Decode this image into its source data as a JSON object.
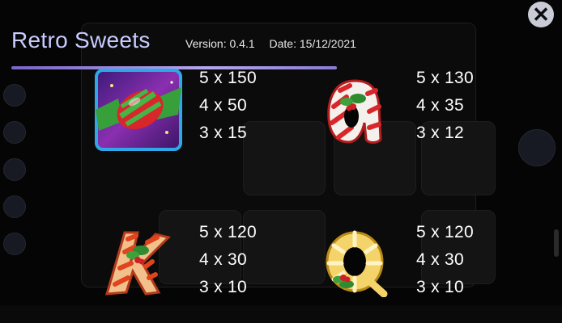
{
  "header": {
    "title": "Retro Sweets",
    "version": "Version: 0.4.1",
    "date": "Date: 15/12/2021"
  },
  "close_icon": "close-icon",
  "paytable": [
    {
      "symbol": "candy-wrapper-icon",
      "payouts": [
        "5 x 150",
        "4 x 50",
        "3 x 15"
      ]
    },
    {
      "symbol": "letter-a-candy-icon",
      "payouts": [
        "5 x 130",
        "4 x 35",
        "3 x 12"
      ]
    },
    {
      "symbol": "letter-k-candy-icon",
      "payouts": [
        "5 x 120",
        "4 x 30",
        "3 x 10"
      ]
    },
    {
      "symbol": "letter-q-candy-icon",
      "payouts": [
        "5 x 120",
        "4 x 30",
        "3 x 10"
      ]
    }
  ]
}
